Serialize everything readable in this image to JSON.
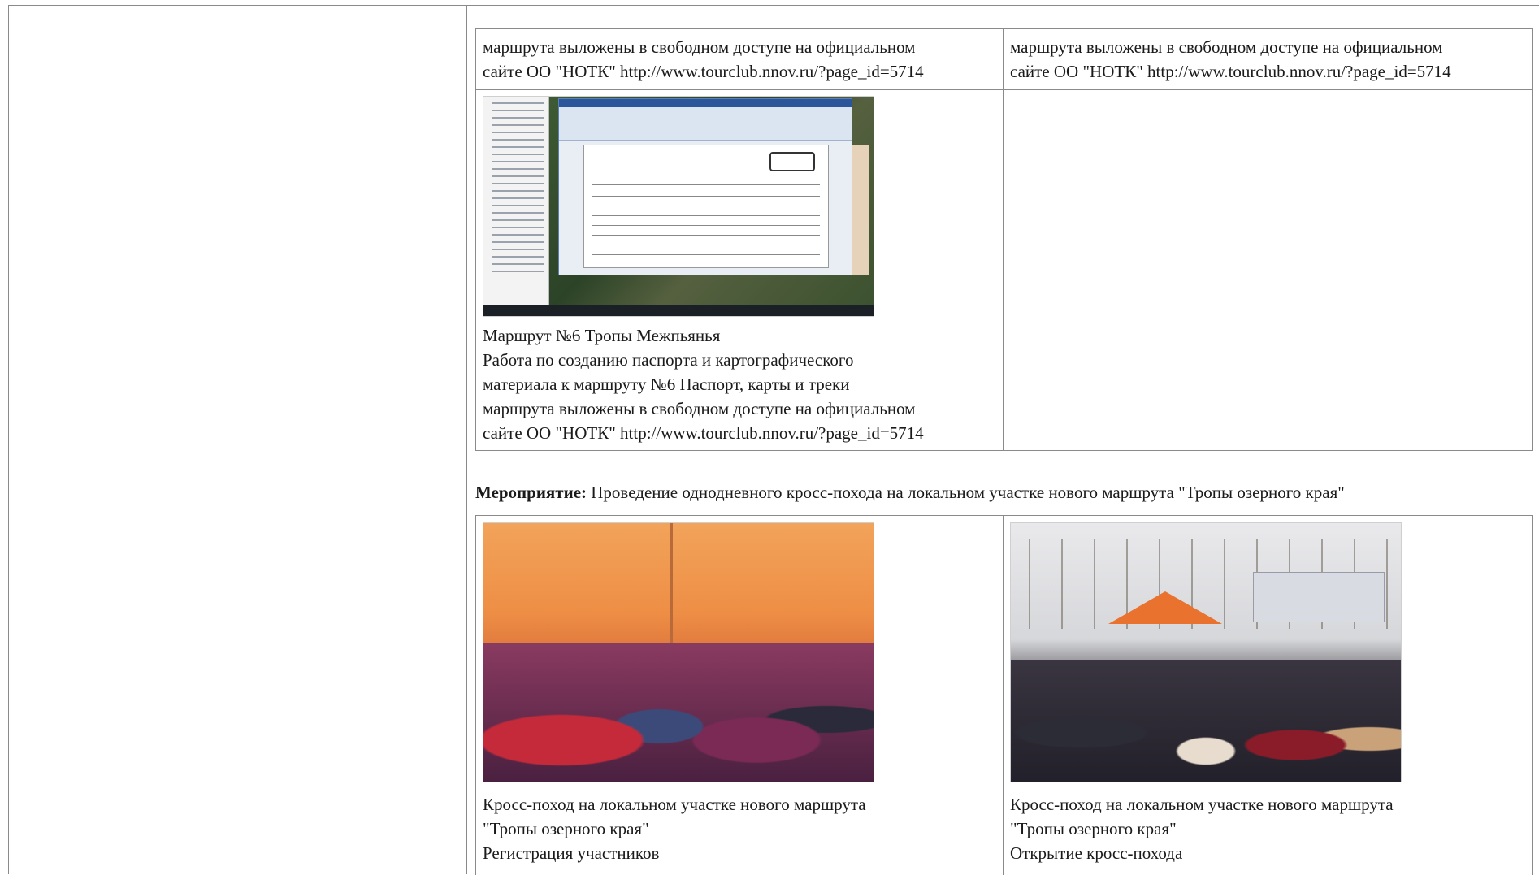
{
  "table1": {
    "row1": {
      "left": "маршрута выложены в свободном доступе на официальном\nсайте ОО \"НОТК\" http://www.tourclub.nnov.ru/?page_id=5714",
      "right": "маршрута выложены в свободном доступе на официальном\nсайте ОО \"НОТК\" http://www.tourclub.nnov.ru/?page_id=5714"
    },
    "row2": {
      "caption": "Маршрут №6 Тропы Межпьянья\nРабота по созданию паспорта и картографического\nматериала к маршруту №6 Паспорт, карты и треки\nмаршрута выложены в свободном доступе на официальном\nсайте ОО \"НОТК\" http://www.tourclub.nnov.ru/?page_id=5714"
    }
  },
  "event": {
    "label": "Мероприятие:",
    "text": " Проведение однодневного кросс-похода на локальном участке нового маршрута \"Тропы озерного края\""
  },
  "table2": {
    "left_caption": "Кросс-поход на локальном участке нового маршрута\n\"Тропы озерного края\"\nРегистрация участников",
    "right_caption": "Кросс-поход на локальном участке нового маршрута\n\"Тропы озерного края\"\nОткрытие кросс-похода"
  }
}
